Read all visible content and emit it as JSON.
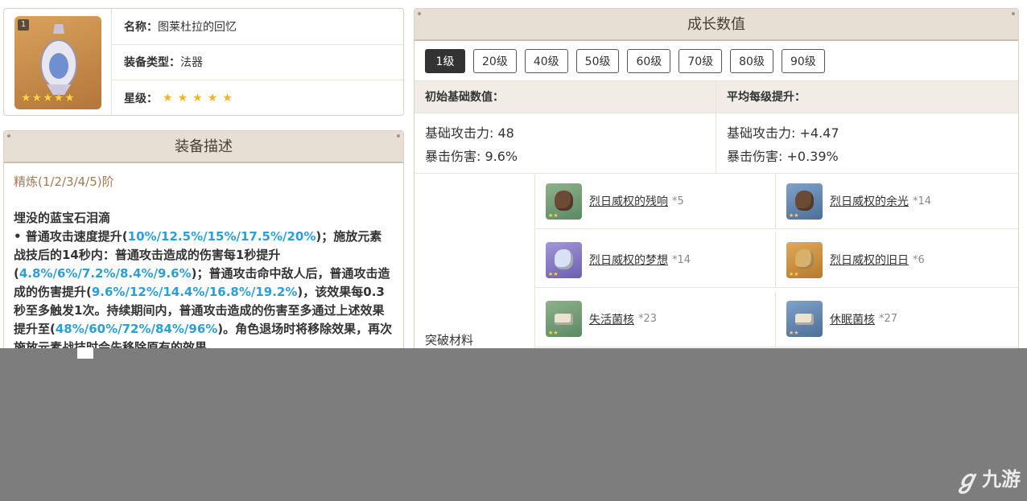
{
  "weapon": {
    "rank": "1",
    "stars_display": "★★★★★",
    "name_label": "名称：",
    "name": "图莱杜拉的回忆",
    "type_label": "装备类型：",
    "type": "法器",
    "rarity_label": "星级：",
    "rarity": 5
  },
  "description": {
    "title": "装备描述",
    "refine": "精炼(1/2/3/4/5)阶",
    "skill_name": "埋没的蓝宝石泪滴",
    "p1": "• 普通攻击速度提升(",
    "h1": "10%/12.5%/15%/17.5%/20%",
    "p2": ")；施放元素战技后的14秒内：普通攻击造成的伤害每1秒提升(",
    "h2": "4.8%/6%/7.2%/8.4%/9.6%",
    "p3": ")；普通攻击命中敌人后，普通攻击造成的伤害提升(",
    "h3": "9.6%/12%/14.4%/16.8%/19.2%",
    "p4": ")，该效果每0.3秒至多触发1次。持续期间内，普通攻击造成的伤害至多通过上述效果提升至(",
    "h4": "48%/60%/72%/84%/96%",
    "p5": ")。角色退场时将移除效果，再次施放元素战技时会先移除原有的效果。"
  },
  "growth": {
    "title": "成长数值",
    "levels": [
      "1级",
      "20级",
      "40级",
      "50级",
      "60级",
      "70级",
      "80级",
      "90级"
    ],
    "active_level": "1级",
    "base_header": "初始基础数值：",
    "avg_header": "平均每级提升：",
    "base_atk": "基础攻击力: 48",
    "base_crit": "暴击伤害: 9.6%",
    "avg_atk": "基础攻击力: +4.47",
    "avg_crit": "暴击伤害: +0.39%",
    "materials_label": "突破材料",
    "materials": [
      {
        "name": "烈日威权的残响",
        "count": "*5",
        "icon": "relic-fragment-icon"
      },
      {
        "name": "烈日威权的余光",
        "count": "*14",
        "icon": "relic-fragment-icon"
      },
      {
        "name": "烈日威权的梦想",
        "count": "*14",
        "icon": "relic-fragment-icon"
      },
      {
        "name": "烈日威权的旧日",
        "count": "*6",
        "icon": "relic-fragment-icon"
      },
      {
        "name": "失活菌核",
        "count": "*23",
        "icon": "fungal-nucleus-icon"
      },
      {
        "name": "休眠菌核",
        "count": "*27",
        "icon": "fungal-nucleus-icon"
      }
    ]
  },
  "watermark": "九游",
  "colors": {
    "highlight": "#2b9fd6",
    "refine": "#a57a52",
    "panel_head": "#e7dfd4",
    "overlay_gray": "#7d7d7d"
  }
}
